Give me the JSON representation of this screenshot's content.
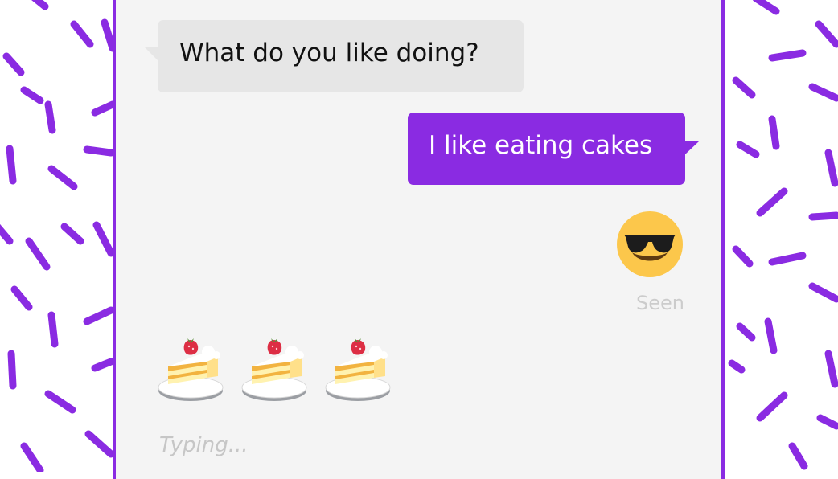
{
  "theme": {
    "accent": "#8a2be2",
    "panel_bg": "#f4f4f4",
    "incoming_bubble_bg": "#e6e6e6",
    "outgoing_bubble_bg": "#8a2be2",
    "muted_text": "#c6c6c6"
  },
  "background": {
    "pattern": "purple-sprinkles"
  },
  "chat": {
    "messages": [
      {
        "direction": "incoming",
        "type": "text",
        "text": "What do you like doing?"
      },
      {
        "direction": "outgoing",
        "type": "text",
        "text": "I like eating cakes"
      },
      {
        "direction": "outgoing",
        "type": "emoji",
        "icon": "smiling-face-with-sunglasses-icon"
      }
    ],
    "status": {
      "seen_label": "Seen"
    },
    "incoming_emoji_message": {
      "icons": [
        "shortcake-icon",
        "shortcake-icon",
        "shortcake-icon"
      ]
    },
    "typing_indicator": "Typing..."
  }
}
